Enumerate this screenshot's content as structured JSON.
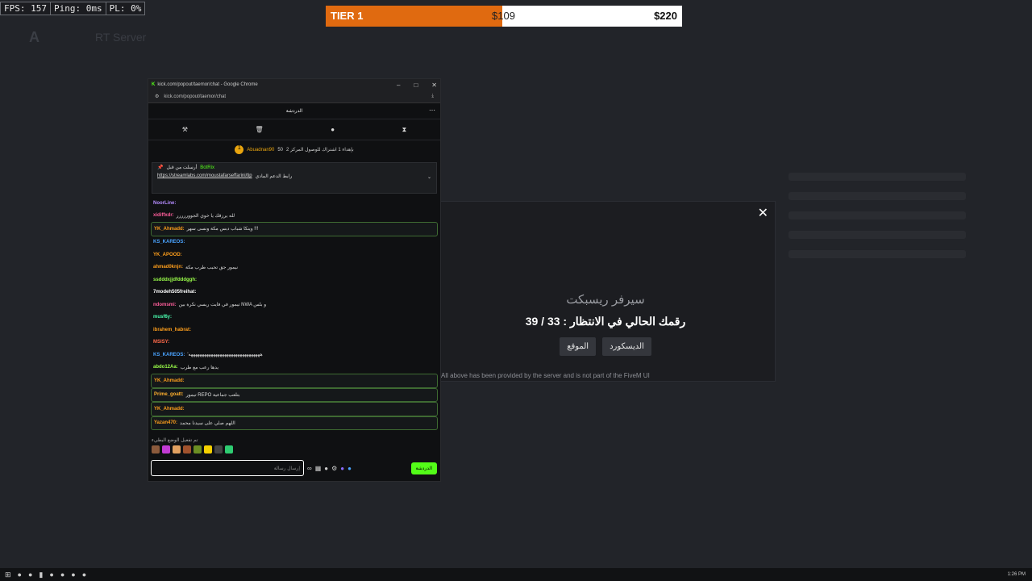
{
  "hud": {
    "fps": "FPS: 157",
    "ping": "Ping: 0ms",
    "pl": "PL: 0%"
  },
  "tier": {
    "name": "TIER 1",
    "current": "$109",
    "goal": "$220",
    "progress": 0.495
  },
  "modal": {
    "server": "سيرفر ريسبكت",
    "queue": "رقمك الحالي في الانتظار : 33 / 39",
    "btn_site": "الموقع",
    "btn_discord": "الديسكورد",
    "footer": "All above has been provided by the server and is not part of the FiveM UI"
  },
  "browser": {
    "title": "kick.com/popout/taemor/chat - Google Chrome",
    "url": "kick.com/popout/taemor/chat",
    "chat_title": "الدردشة"
  },
  "pinned_user": {
    "name": "Abuadnan90",
    "count": "50",
    "note": "بإهداء 1 اشتراك للوصول المركز 2"
  },
  "pinned": {
    "by": "أرسلت من قبل",
    "bot": "BotRix",
    "link": "https://streamlabs.com/moustafarseffarini/tip",
    "label": "رابط الدعم المادي"
  },
  "messages": [
    {
      "user": "NoorLine:",
      "text": "",
      "color": "#b58cff",
      "hl": false
    },
    {
      "user": "xidiffxdr:",
      "text": "لله يرزقك يا خوي الجووررررر",
      "color": "#ff5e9b",
      "hl": false
    },
    {
      "user": "YK_Ahmadd:",
      "text": "وينكا شباب دبس مكة ونسى سهر !!!",
      "color": "#ff9f1c",
      "hl": true
    },
    {
      "user": "KS_KAREOS:",
      "text": "",
      "color": "#4aa3ff",
      "hl": false
    },
    {
      "user": "YK_APOOD:",
      "text": "",
      "color": "#ff9f1c",
      "hl": false
    },
    {
      "user": "ahmad0knjn:",
      "text": "نيمور جق تحبب طرب مكة",
      "color": "#ff9f1c",
      "hl": false
    },
    {
      "user": "ssdddxjjdfdddggh:",
      "text": "",
      "color": "#9bff4a",
      "hl": false
    },
    {
      "user": "7modeh505freihat:",
      "text": "",
      "color": "#ffffff",
      "hl": false
    },
    {
      "user": "ndomsmi:",
      "text": "تيمور في فايت ريسي نكرة بين NWA و بلس",
      "color": "#ff5e9b",
      "hl": false
    },
    {
      "user": "musf6y:",
      "text": "",
      "color": "#4affb0",
      "hl": false
    },
    {
      "user": "ibrahem_habrat:",
      "text": "",
      "color": "#ff9f1c",
      "hl": false
    },
    {
      "user": "MSISY:",
      "text": "",
      "color": "#ff6a4a",
      "hl": false
    },
    {
      "user": "KS_KAREOS:",
      "text": "'ههههههههههههههههههههههههههههههههه",
      "color": "#4aa3ff",
      "hl": false
    },
    {
      "user": "abdo12Aa:",
      "text": "يدها رعب مع طرب",
      "color": "#9bff4a",
      "hl": false
    },
    {
      "user": "YK_Ahmadd:",
      "text": "",
      "color": "#ff9f1c",
      "hl": true
    },
    {
      "user": "Prime_goatt:",
      "text": "تيمور REPO بتلعب جماعية",
      "color": "#ffb02e",
      "hl": true
    },
    {
      "user": "YK_Ahmadd:",
      "text": "",
      "color": "#ff9f1c",
      "hl": true
    },
    {
      "user": "Yazan470:",
      "text": "اللهم صلي على سيدنا محمد",
      "color": "#ff9f1c",
      "hl": true
    }
  ],
  "emote_bar_label": "تم تفعيل الوضع البطيء",
  "input": {
    "placeholder": "إرسال رسالة",
    "send": "الدردشة"
  },
  "taskbar": {
    "time": "1:26 PM"
  },
  "background": {
    "title": "RT Server"
  }
}
